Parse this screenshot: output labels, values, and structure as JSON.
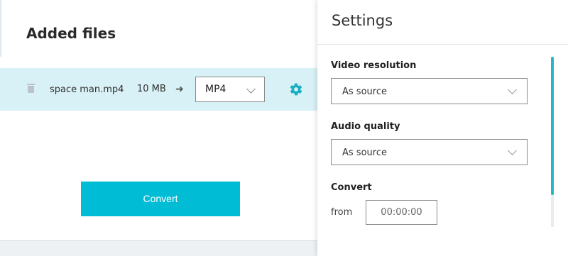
{
  "main": {
    "title": "Added files",
    "file": {
      "name": "space man.mp4",
      "size": "10 MB",
      "format": "MP4"
    },
    "convert_label": "Convert"
  },
  "settings": {
    "title": "Settings",
    "video_resolution": {
      "label": "Video resolution",
      "value": "As source"
    },
    "audio_quality": {
      "label": "Audio quality",
      "value": "As source"
    },
    "convert": {
      "label": "Convert",
      "from_label": "from",
      "from_value": "00:00:00"
    }
  },
  "colors": {
    "accent": "#00bcd4",
    "row_highlight": "#d8f1f6",
    "gear": "#1aaec3"
  },
  "icons": [
    "trash-icon",
    "arrow-right-icon",
    "chevron-down-icon",
    "gear-icon"
  ]
}
